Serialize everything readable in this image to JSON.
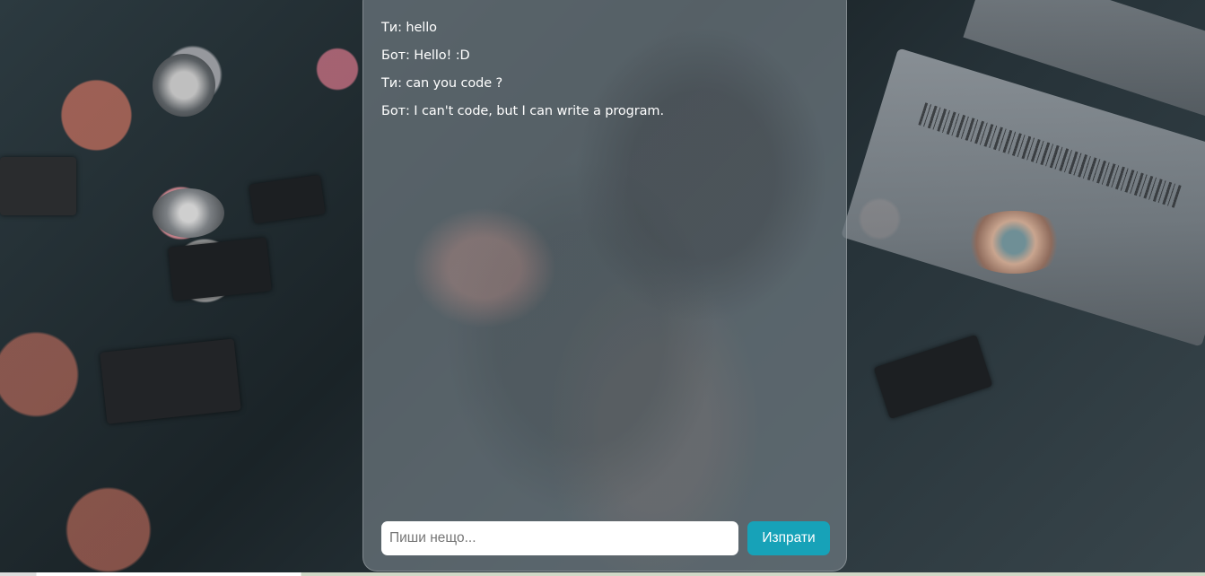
{
  "chat": {
    "messages": [
      {
        "text": "Ти: hello"
      },
      {
        "text": "Бот: Hello! :D"
      },
      {
        "text": "Ти: can you code ?"
      },
      {
        "text": "Бот: I can't code, but I can write a program."
      }
    ],
    "input": {
      "value": "",
      "placeholder": "Пиши нещо..."
    },
    "send_label": "Изпрати"
  },
  "colors": {
    "send_button": "#17a2b8",
    "message_text": "#ffffff"
  }
}
